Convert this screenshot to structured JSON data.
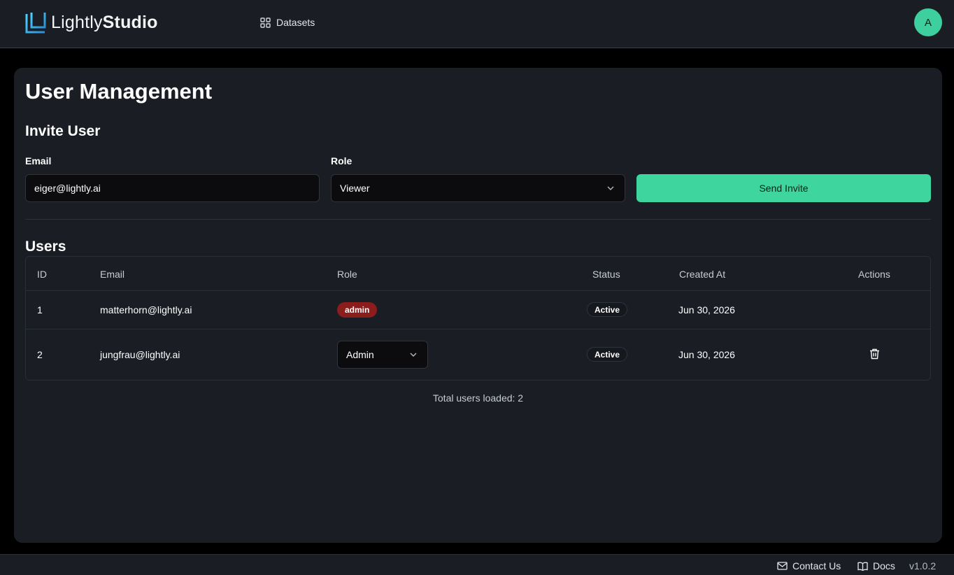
{
  "app": {
    "logo_text_light": "Lightly",
    "logo_text_bold": "Studio",
    "nav_datasets": "Datasets",
    "avatar_initial": "A",
    "accent_color": "#3ed59f"
  },
  "page": {
    "title": "User Management"
  },
  "invite": {
    "section_title": "Invite User",
    "email_label": "Email",
    "email_value": "eiger@lightly.ai",
    "role_label": "Role",
    "role_value": "Viewer",
    "send_button": "Send Invite"
  },
  "users": {
    "section_title": "Users",
    "columns": [
      "ID",
      "Email",
      "Role",
      "Status",
      "Created At",
      "Actions"
    ],
    "rows": [
      {
        "id": "1",
        "email": "matterhorn@lightly.ai",
        "role_badge": "admin",
        "status": "Active",
        "created_at": "Jun 30, 2026"
      },
      {
        "id": "2",
        "email": "jungfrau@lightly.ai",
        "role_select": "Admin",
        "status": "Active",
        "created_at": "Jun 30, 2026",
        "action_icon": "trash-icon"
      }
    ],
    "total_text": "Total users loaded: 2"
  },
  "footer": {
    "contact": "Contact Us",
    "docs": "Docs",
    "version": "v1.0.2"
  }
}
